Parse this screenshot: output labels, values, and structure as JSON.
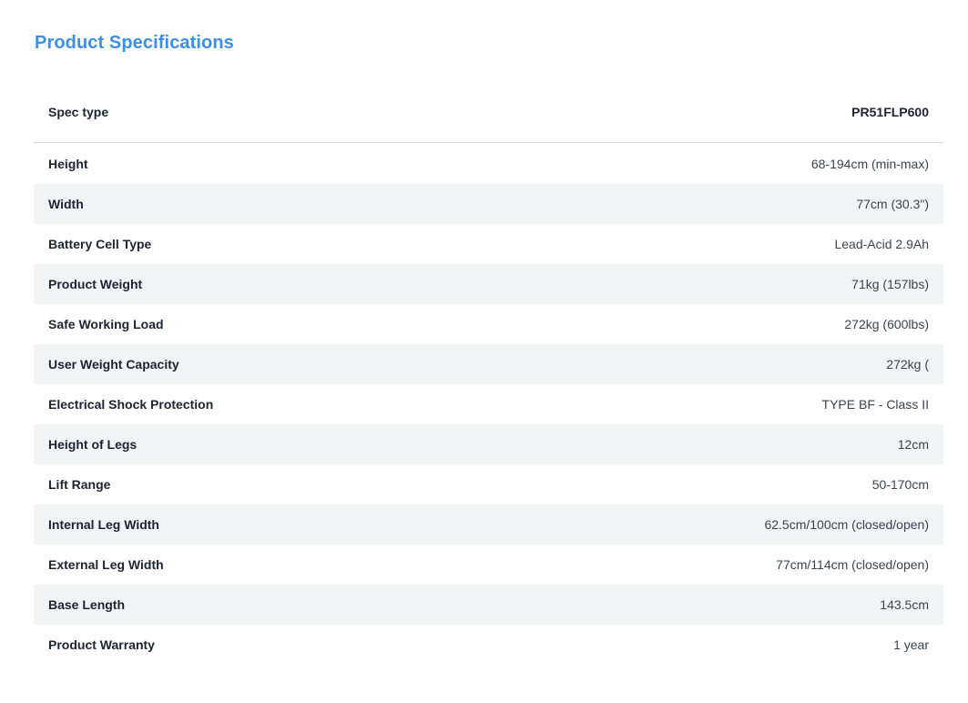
{
  "title": "Product Specifications",
  "header": {
    "label": "Spec type",
    "value": "PR51FLP600"
  },
  "specs": [
    {
      "label": "Height",
      "value": "68-194cm (min-max)"
    },
    {
      "label": "Width",
      "value": "77cm (30.3\")"
    },
    {
      "label": "Battery Cell Type",
      "value": "Lead-Acid 2.9Ah"
    },
    {
      "label": "Product Weight",
      "value": "71kg (157lbs)"
    },
    {
      "label": "Safe Working Load",
      "value": "272kg (600lbs)"
    },
    {
      "label": "User Weight Capacity",
      "value": "272kg ("
    },
    {
      "label": "Electrical Shock Protection",
      "value": "TYPE BF - Class II"
    },
    {
      "label": "Height of Legs",
      "value": "12cm"
    },
    {
      "label": "Lift Range",
      "value": "50-170cm"
    },
    {
      "label": "Internal Leg Width",
      "value": "62.5cm/100cm (closed/open)"
    },
    {
      "label": "External Leg Width",
      "value": "77cm/114cm (closed/open)"
    },
    {
      "label": "Base Length",
      "value": "143.5cm"
    },
    {
      "label": "Product Warranty",
      "value": "1 year"
    }
  ],
  "colors": {
    "title": "#3b8fe8",
    "row_shade": "#f2f3f5",
    "divider": "#d3d6da"
  }
}
